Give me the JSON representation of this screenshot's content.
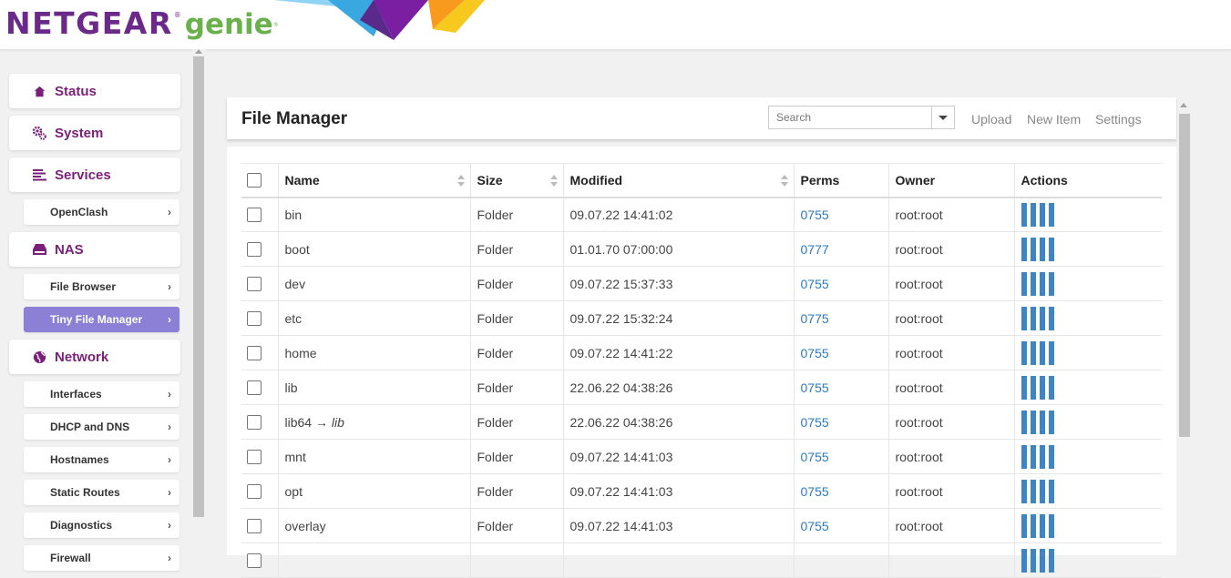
{
  "header": {
    "logo_main": "NETGEAR",
    "logo_reg": "®",
    "logo_sub": "genie",
    "logo_sub_reg": "®"
  },
  "sidebar": {
    "categories": [
      {
        "label": "Status",
        "icon": "home-icon"
      },
      {
        "label": "System",
        "icon": "gears-icon"
      },
      {
        "label": "Services",
        "icon": "list-icon"
      },
      {
        "label": "NAS",
        "icon": "drive-icon"
      },
      {
        "label": "Network",
        "icon": "globe-icon"
      }
    ],
    "subitems": [
      {
        "label": "OpenClash",
        "active": false
      },
      {
        "label": "File Browser",
        "active": false
      },
      {
        "label": "Tiny File Manager",
        "active": true
      },
      {
        "label": "Interfaces",
        "active": false
      },
      {
        "label": "DHCP and DNS",
        "active": false
      },
      {
        "label": "Hostnames",
        "active": false
      },
      {
        "label": "Static Routes",
        "active": false
      },
      {
        "label": "Diagnostics",
        "active": false
      },
      {
        "label": "Firewall",
        "active": false
      }
    ],
    "chevron": "›"
  },
  "panel": {
    "title": "File Manager",
    "search_placeholder": "Search",
    "upload_label": "Upload",
    "new_item_label": "New Item",
    "settings_label": "Settings"
  },
  "table": {
    "columns": [
      "Name",
      "Size",
      "Modified",
      "Perms",
      "Owner",
      "Actions"
    ],
    "rows": [
      {
        "name": "bin",
        "size": "Folder",
        "modified": "09.07.22 14:41:02",
        "perms": "0755",
        "owner": "root:root"
      },
      {
        "name": "boot",
        "size": "Folder",
        "modified": "01.01.70 07:00:00",
        "perms": "0777",
        "owner": "root:root"
      },
      {
        "name": "dev",
        "size": "Folder",
        "modified": "09.07.22 15:37:33",
        "perms": "0755",
        "owner": "root:root"
      },
      {
        "name": "etc",
        "size": "Folder",
        "modified": "09.07.22 15:32:24",
        "perms": "0775",
        "owner": "root:root"
      },
      {
        "name": "home",
        "size": "Folder",
        "modified": "09.07.22 14:41:22",
        "perms": "0755",
        "owner": "root:root"
      },
      {
        "name": "lib",
        "size": "Folder",
        "modified": "22.06.22 04:38:26",
        "perms": "0755",
        "owner": "root:root"
      },
      {
        "name": "lib64",
        "link_arrow": "→",
        "link_target": "lib",
        "size": "Folder",
        "modified": "22.06.22 04:38:26",
        "perms": "0755",
        "owner": "root:root"
      },
      {
        "name": "mnt",
        "size": "Folder",
        "modified": "09.07.22 14:41:03",
        "perms": "0755",
        "owner": "root:root"
      },
      {
        "name": "opt",
        "size": "Folder",
        "modified": "09.07.22 14:41:03",
        "perms": "0755",
        "owner": "root:root"
      },
      {
        "name": "overlay",
        "size": "Folder",
        "modified": "09.07.22 14:41:03",
        "perms": "0755",
        "owner": "root:root"
      },
      {
        "name": "",
        "size": "",
        "modified": "",
        "perms": "",
        "owner": ""
      }
    ],
    "action_icons": [
      "delete-icon",
      "rename-icon",
      "copy-icon",
      "link-icon"
    ]
  },
  "colors": {
    "brand_purple": "#7b1f7a",
    "brand_green": "#6ab04c",
    "active_item": "#8c7fd6",
    "perm_link": "#2a7ac2",
    "action_blue": "#3d85c6"
  }
}
